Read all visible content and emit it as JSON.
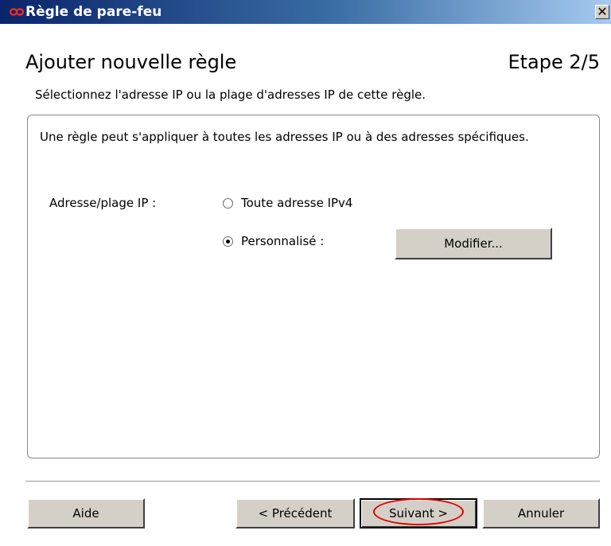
{
  "window": {
    "title": "Règle de pare-feu",
    "close_symbol": "✕",
    "app_icon": "infinity-logo-icon",
    "colors": {
      "titlebar": "#0a246a",
      "accent_red": "#e00000",
      "button_face": "#d4d0c8"
    }
  },
  "header": {
    "title": "Ajouter nouvelle règle",
    "step": "Etape 2/5",
    "subtitle": "Sélectionnez l'adresse IP ou la plage d'adresses IP de cette règle."
  },
  "panel": {
    "description": "Une règle peut s'appliquer à toutes les adresses IP ou à des adresses spécifiques.",
    "ip_label": "Adresse/plage IP :",
    "options": [
      {
        "label": "Toute adresse IPv4",
        "checked": false
      },
      {
        "label": "Personnalisé :",
        "checked": true
      }
    ],
    "modify_button": "Modifier..."
  },
  "footer": {
    "help_button": "Aide",
    "previous_button": "< Précédent",
    "next_button": "Suivant >",
    "cancel_button": "Annuler",
    "highlighted": "Suivant >"
  }
}
